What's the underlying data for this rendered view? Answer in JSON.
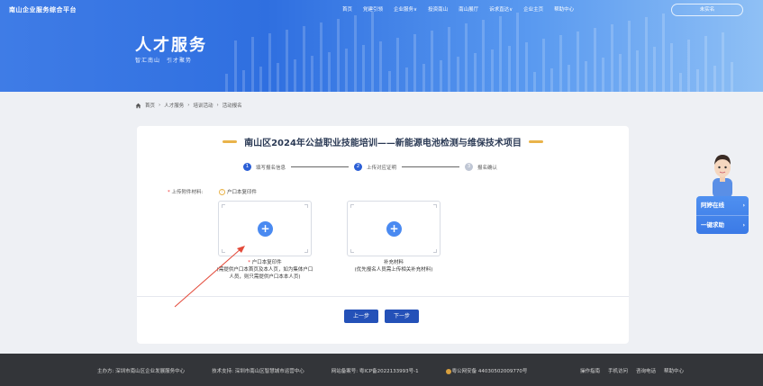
{
  "header": {
    "logo": "南山企业服务综合平台",
    "nav": [
      "首页",
      "党建引领",
      "企业服务∨",
      "投资南山",
      "南山展厅",
      "诉求直达∨",
      "企业主页",
      "帮助中心"
    ],
    "login": "未实名",
    "title": "人才服务",
    "subtitle": "智汇南山　引才聚势"
  },
  "breadcrumb": [
    "首页",
    "人才服务",
    "培训活动",
    "活动报名"
  ],
  "breadcrumb_sep": "›",
  "form": {
    "title": "南山区2024年公益职业技能培训——新能源电池检测与维保技术项目",
    "steps": [
      {
        "num": "1",
        "label": "填写报名信息"
      },
      {
        "num": "2",
        "label": "上传对应证明"
      },
      {
        "num": "3",
        "label": "报名确认"
      }
    ],
    "upload_label_req": "*",
    "upload_label": "上传附件材料:",
    "upload_hint": "户口本复印件",
    "upload1_req": "*",
    "upload1_title": "户口本复印件",
    "upload1_desc": "(需提供户口本首页及本人页，如为集体户口人员，则只需提供户口本本人页)",
    "upload2_title": "补充材料",
    "upload2_desc": "(优先报名人员需上传相关补充材料)",
    "prev_label": "上一步",
    "next_label": "下一步"
  },
  "side": {
    "online": "阿婷在线",
    "help": "一键求助",
    "chevron": "›"
  },
  "footer": {
    "host": "主办方:  深圳市南山区企业发展服务中心",
    "tech": "技术支持:  深圳市南山区智慧城市运营中心",
    "icp": "网站备案号:  粤ICP备2022133993号-1",
    "police": "粤公网安备 44030502009770号",
    "links": [
      "操作指南",
      "手机访问",
      "咨询电话",
      "帮助中心"
    ]
  },
  "colors": {
    "primary": "#2b5fd6",
    "button": "#2451b8",
    "accent": "#e9b34a",
    "footer_bg": "#333539"
  }
}
